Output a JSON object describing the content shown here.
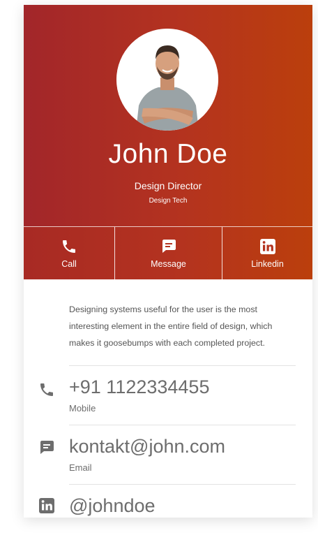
{
  "profile": {
    "name": "John Doe",
    "title": "Design Director",
    "company": "Design Tech"
  },
  "actions": [
    {
      "label": "Call",
      "icon": "phone-icon"
    },
    {
      "label": "Message",
      "icon": "message-icon"
    },
    {
      "label": "Linkedin",
      "icon": "linkedin-icon"
    }
  ],
  "bio": "Designing systems useful for the user is the most interesting element in the entire field of design, which makes it goosebumps with each completed project.",
  "contacts": [
    {
      "value": "+91 1122334455",
      "label": "Mobile",
      "icon": "phone-icon"
    },
    {
      "value": "kontakt@john.com",
      "label": "Email",
      "icon": "message-icon"
    },
    {
      "value": "@johndoe",
      "label": "",
      "icon": "linkedin-icon"
    }
  ],
  "colors": {
    "gradient_start": "#a2262a",
    "gradient_end": "#bb3f0c",
    "icon_gray": "#6d6d6d"
  }
}
